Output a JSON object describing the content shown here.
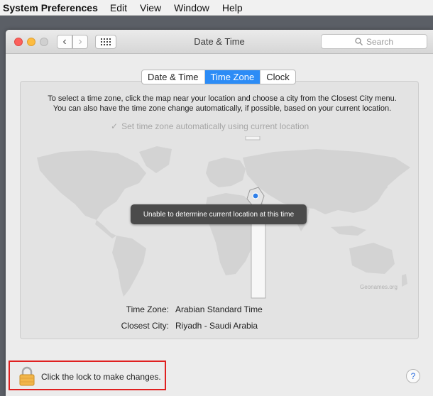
{
  "menubar": {
    "app_name": "System Preferences",
    "items": [
      "Edit",
      "View",
      "Window",
      "Help"
    ]
  },
  "window": {
    "title": "Date & Time",
    "search_placeholder": "Search",
    "nav_icons": [
      "chevron-left-icon",
      "chevron-right-icon",
      "grid-icon"
    ]
  },
  "tabs": [
    {
      "label": "Date & Time",
      "active": false
    },
    {
      "label": "Time Zone",
      "active": true
    },
    {
      "label": "Clock",
      "active": false
    }
  ],
  "timezone_pane": {
    "instruction_line1": "To select a time zone, click the map near your location and choose a city from the Closest City menu.",
    "instruction_line2": "You can also have the time zone change automatically, if possible, based on your current location.",
    "auto_checkbox_label": "Set time zone automatically using current location",
    "auto_checked": true,
    "tooltip": "Unable to determine current location at this time",
    "map_credit": "Geonames.org",
    "time_zone_label": "Time Zone:",
    "time_zone_value": "Arabian Standard Time",
    "closest_city_label": "Closest City:",
    "closest_city_value": "Riyadh - Saudi Arabia"
  },
  "footer": {
    "lock_text": "Click the lock to make changes.",
    "help_label": "?"
  },
  "colors": {
    "accent": "#2c8cf6",
    "highlight_border": "#e02020",
    "tooltip_bg": "#4b4b4b"
  }
}
